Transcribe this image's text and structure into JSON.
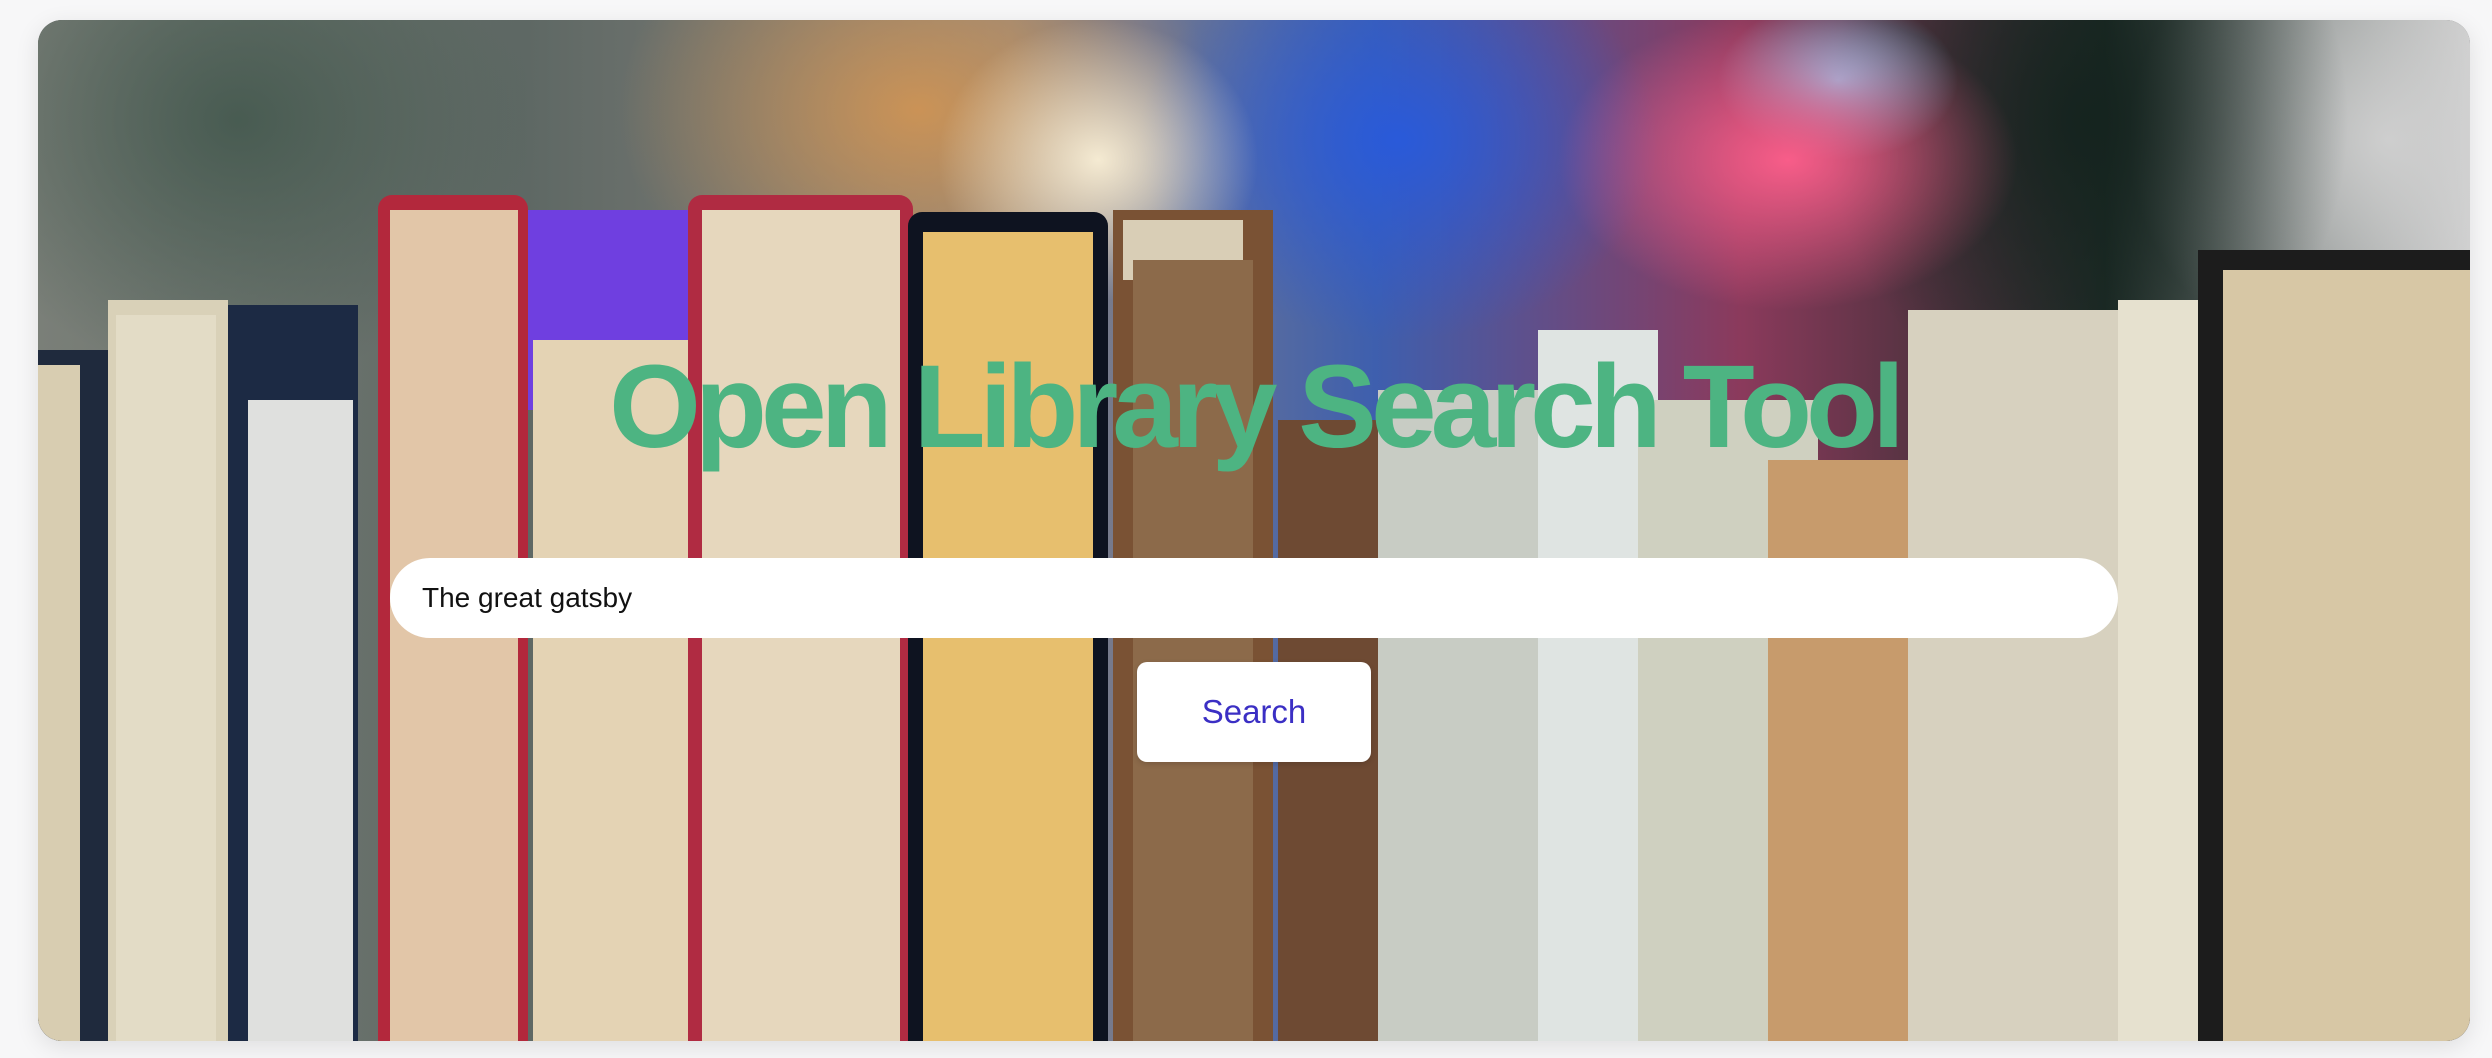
{
  "header": {
    "title": "Open Library Search Tool"
  },
  "search": {
    "value": "The great gatsby",
    "button_label": "Search"
  },
  "colors": {
    "title": "#4db482",
    "button_text": "#3b2fc4"
  }
}
